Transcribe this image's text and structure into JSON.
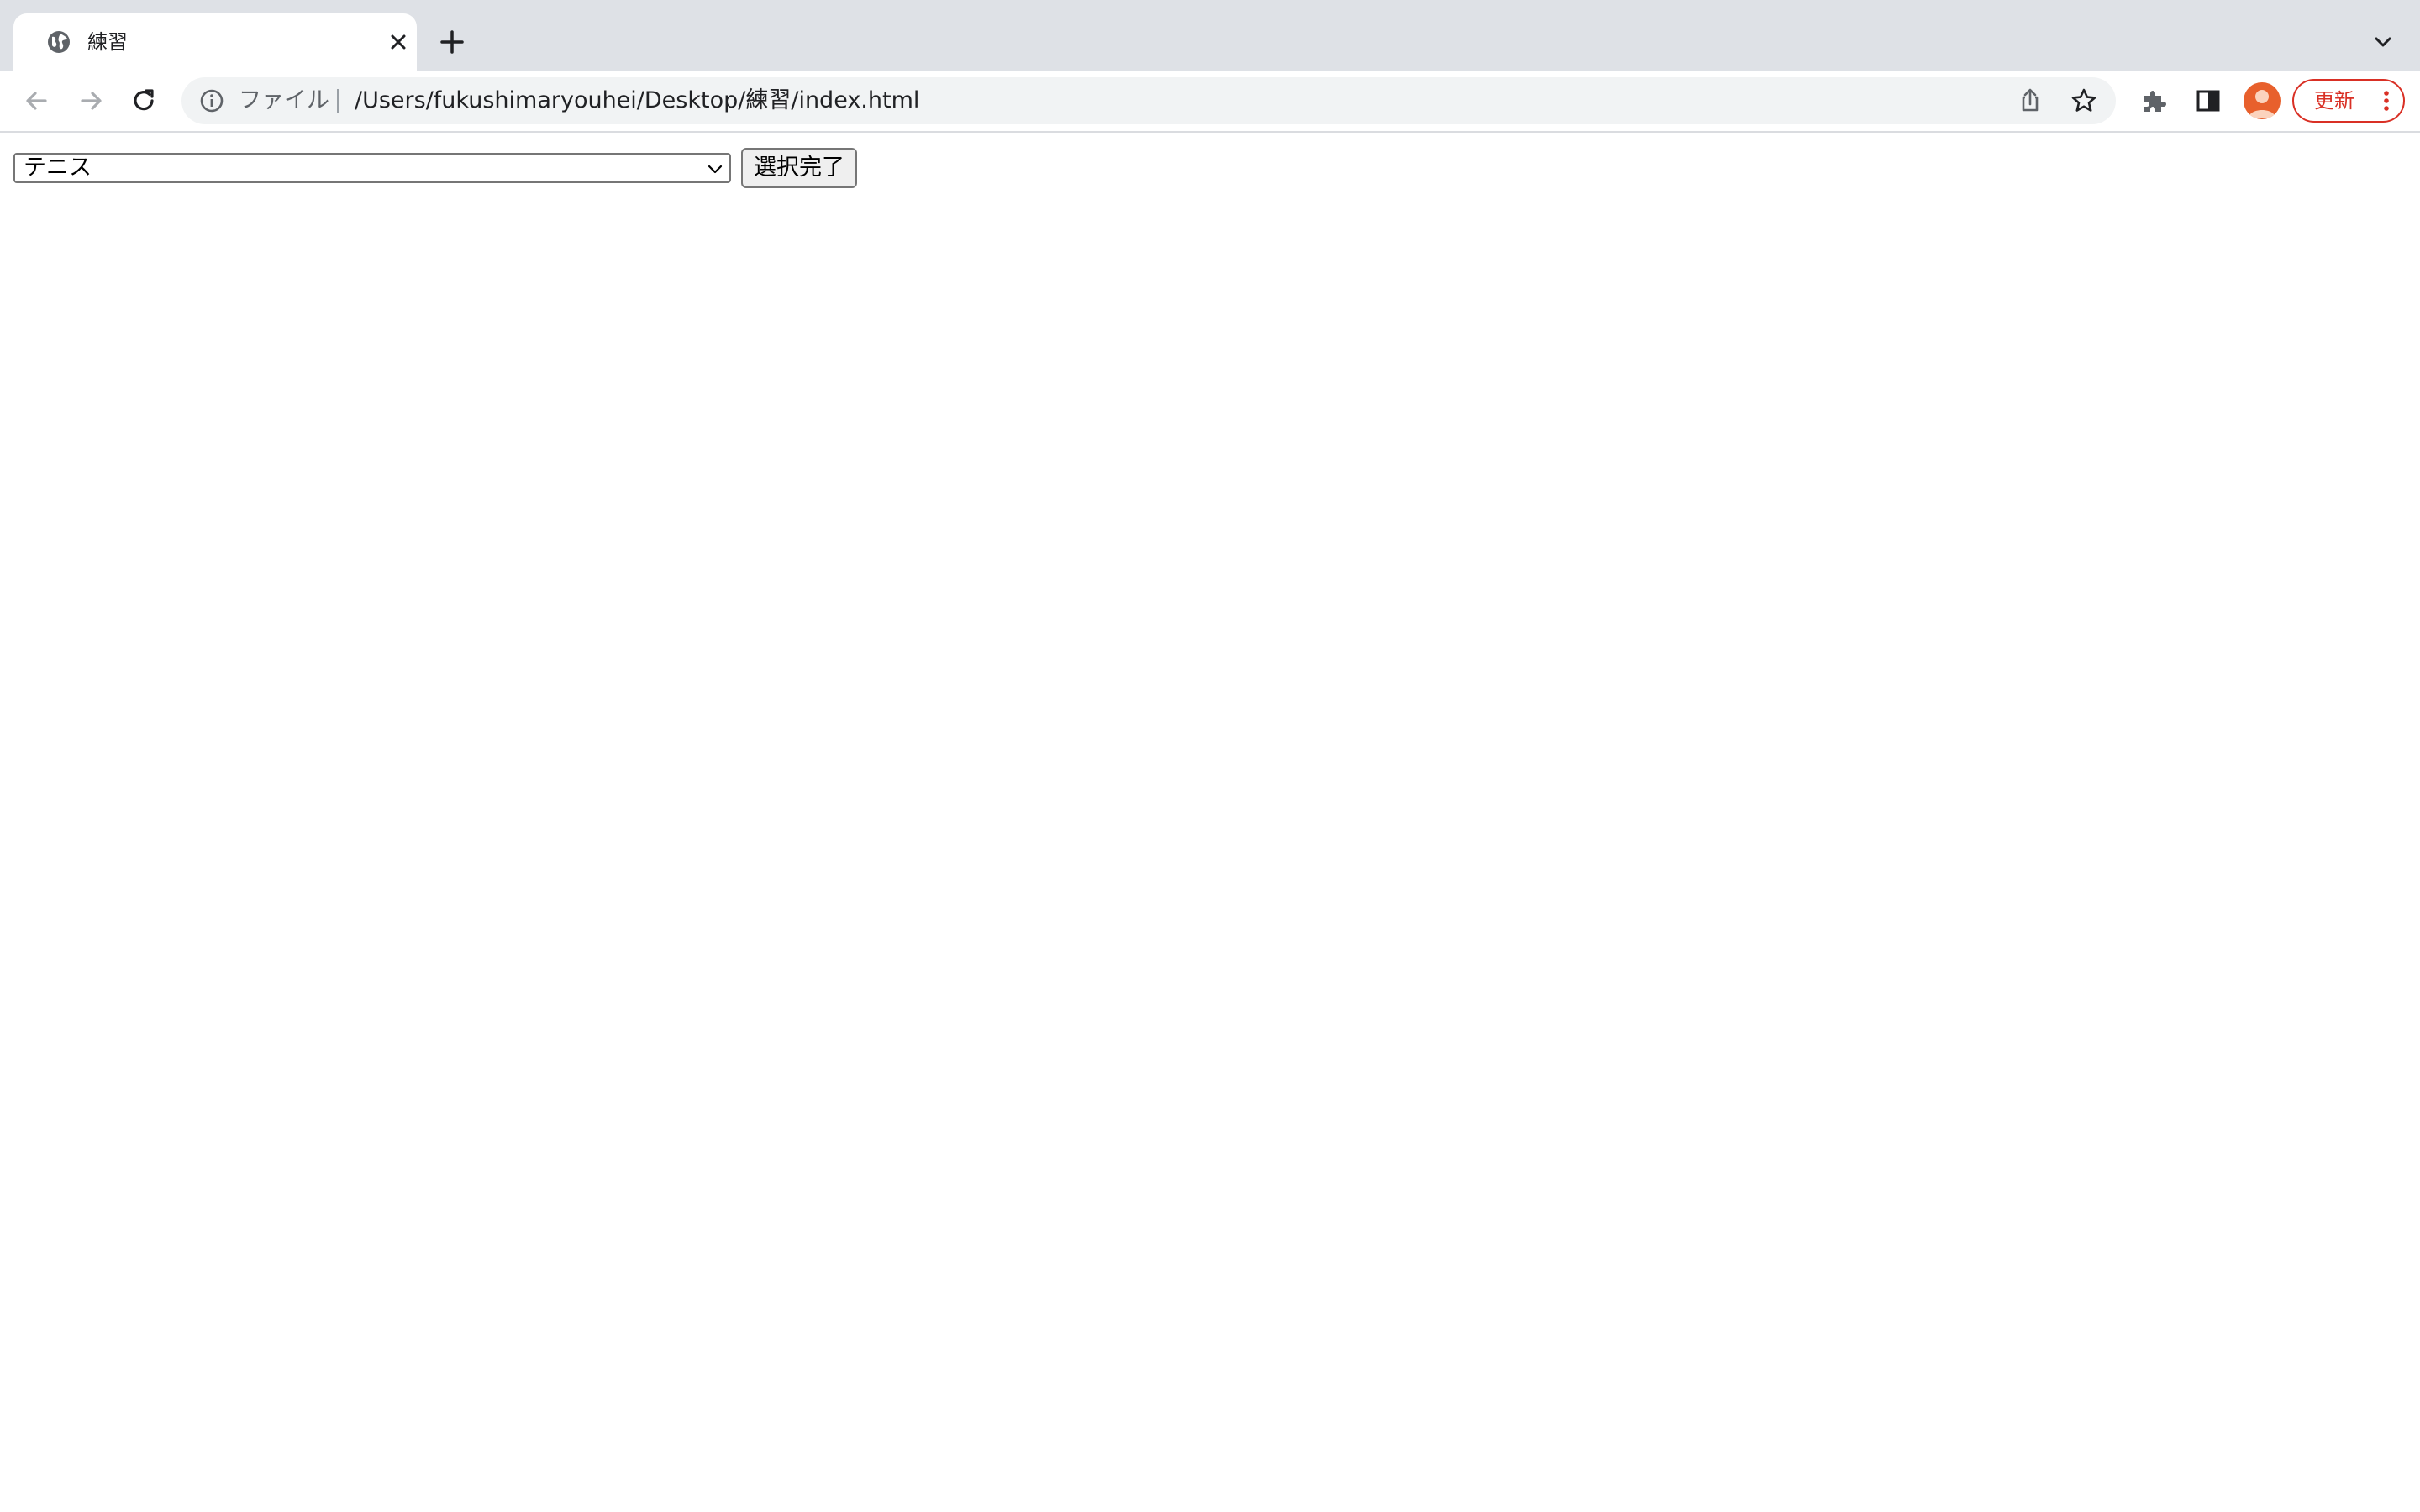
{
  "browser": {
    "tab": {
      "title": "練習",
      "favicon": "globe-icon",
      "close_icon": "close-icon"
    },
    "new_tab_icon": "plus-icon",
    "tab_search_icon": "chevron-down-icon",
    "toolbar": {
      "back_icon": "back-arrow-icon",
      "forward_icon": "forward-arrow-icon",
      "reload_icon": "reload-icon",
      "omnibox": {
        "info_icon": "info-icon",
        "scheme_label": "ファイル",
        "url": "/Users/fukushimaryouhei/Desktop/練習/index.html",
        "share_icon": "share-icon",
        "bookmark_icon": "star-icon"
      },
      "extensions_icon": "puzzle-icon",
      "side_panel_icon": "side-panel-icon",
      "avatar_icon": "profile-avatar-icon",
      "update_button": {
        "label": "更新",
        "menu_icon": "kebab-menu-icon"
      }
    },
    "colors": {
      "tabstrip": "#dee1e6",
      "omnibox": "#f1f3f4",
      "update_accent": "#d93025",
      "avatar": "#e8602c"
    }
  },
  "page": {
    "select": {
      "selected_value": "テニス"
    },
    "submit_button": {
      "label": "選択完了"
    }
  }
}
